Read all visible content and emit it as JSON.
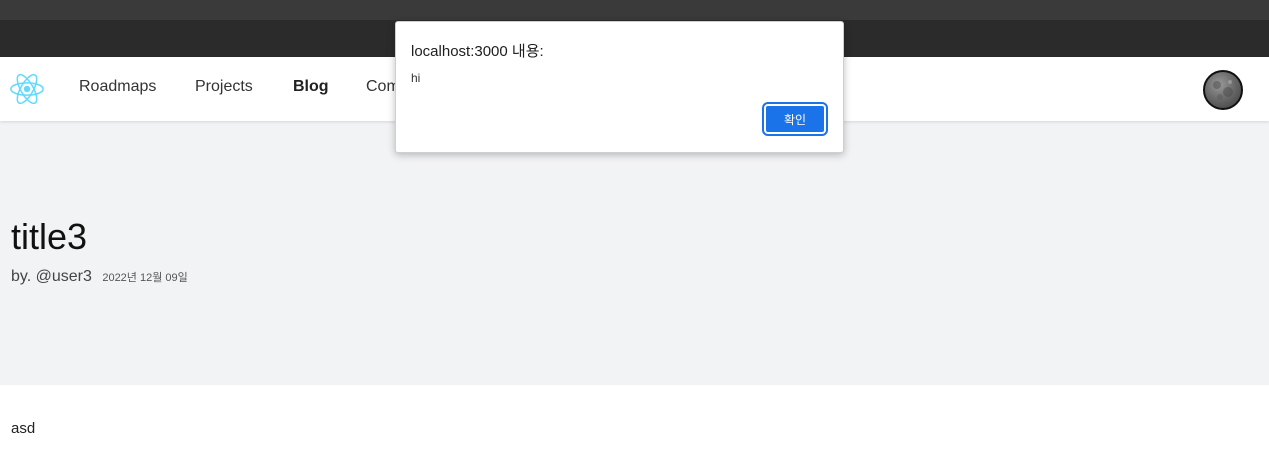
{
  "nav": {
    "logo_icon": "react-logo-icon",
    "links": [
      {
        "label": "Roadmaps"
      },
      {
        "label": "Projects"
      },
      {
        "label": "Blog"
      },
      {
        "label": "Com"
      }
    ],
    "active_link": "Blog",
    "avatar_icon": "moon-avatar"
  },
  "post": {
    "title": "title3",
    "author": "by. @user3",
    "date": "2022년 12월 09일",
    "body": "asd"
  },
  "alert": {
    "title": "localhost:3000 내용:",
    "message": "hi",
    "ok_label": "확인"
  },
  "colors": {
    "accent": "#1a73e8",
    "hero_bg": "#f2f3f5",
    "logo": "#61dafb",
    "browser_bar": "#2b2b2b"
  }
}
